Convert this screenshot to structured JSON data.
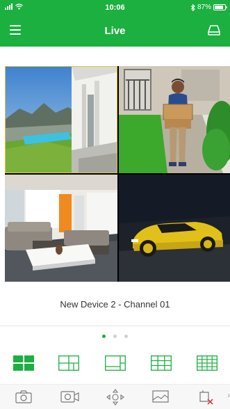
{
  "status_bar": {
    "time": "10:06",
    "battery_text": "87%",
    "battery_level": 0.87
  },
  "nav": {
    "title": "Live",
    "menu_icon": "hamburger-menu-icon",
    "right_icon": "tray-icon"
  },
  "channels": [
    {
      "scene": "modern-house-pool"
    },
    {
      "scene": "delivery-man-with-boxes"
    },
    {
      "scene": "living-room"
    },
    {
      "scene": "yellow-sports-car"
    }
  ],
  "selected_channel_label": "New Device 2 - Channel 01",
  "pagination": {
    "pages": 3,
    "current": 1
  },
  "layout_options": [
    "1x4-grid",
    "split-2",
    "split-2-alt",
    "grid-9",
    "grid-16"
  ],
  "selected_layout": "1x4-grid",
  "toolbar": [
    "snapshot-icon",
    "record-icon",
    "ptz-icon",
    "image-icon",
    "close-stream-icon"
  ],
  "colors": {
    "accent": "#1cb040",
    "selected_border": "#e2c33d",
    "close_red": "#e23b3b"
  }
}
